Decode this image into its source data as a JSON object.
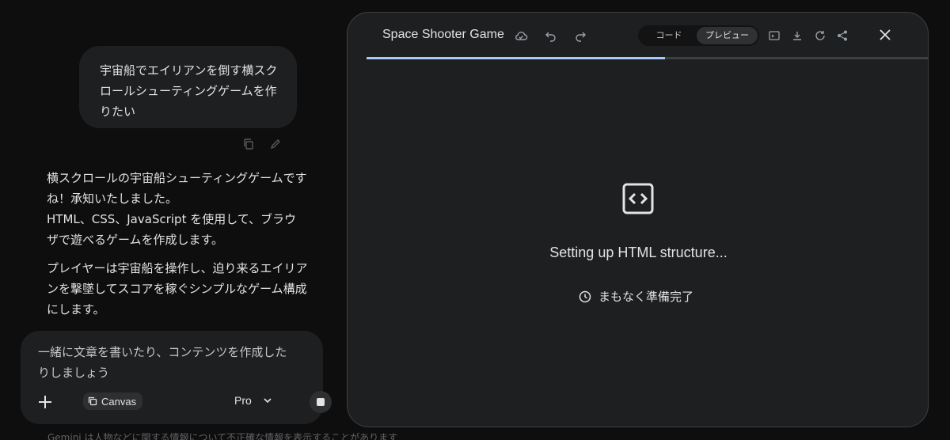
{
  "chat": {
    "user_message": "宇宙船でエイリアンを倒す横スクロールシューティングゲームを作りたい",
    "reply_paragraphs": [
      "横スクロールの宇宙船シューティングゲームですね！承知いたしました。\nHTML、CSS、JavaScript を使用して、ブラウザで遊べるゲームを作成します。",
      "プレイヤーは宇宙船を操作し、迫り来るエイリアンを撃墜してスコアを稼ぐシンプルなゲーム構成にします。"
    ]
  },
  "composer": {
    "placeholder": "一緒に文章を書いたり、コンテンツを作成したりしましょう",
    "canvas_chip": "Canvas",
    "model": "Pro"
  },
  "footer_faded": "Gemini は人物などに関する情報について不正確な情報を表示することがあります",
  "canvas": {
    "title": "Space Shooter Game",
    "tab_code": "コード",
    "tab_preview": "プレビュー",
    "active_tab": "プレビュー",
    "progress_fraction": 0.53,
    "status": "Setting up HTML structure...",
    "eta": "まもなく準備完了"
  },
  "icons": [
    "copy-icon",
    "edit-icon",
    "plus-icon",
    "canvas-icon",
    "chevron-down-icon",
    "stop-icon",
    "cloud-icon",
    "undo-icon",
    "redo-icon",
    "console-icon",
    "download-icon",
    "refresh-icon",
    "share-icon",
    "close-icon",
    "code-icon",
    "clock-icon"
  ],
  "colors": {
    "accent": "#a8c7fa",
    "background": "#0e0e0e",
    "surface": "#1e1f20"
  }
}
